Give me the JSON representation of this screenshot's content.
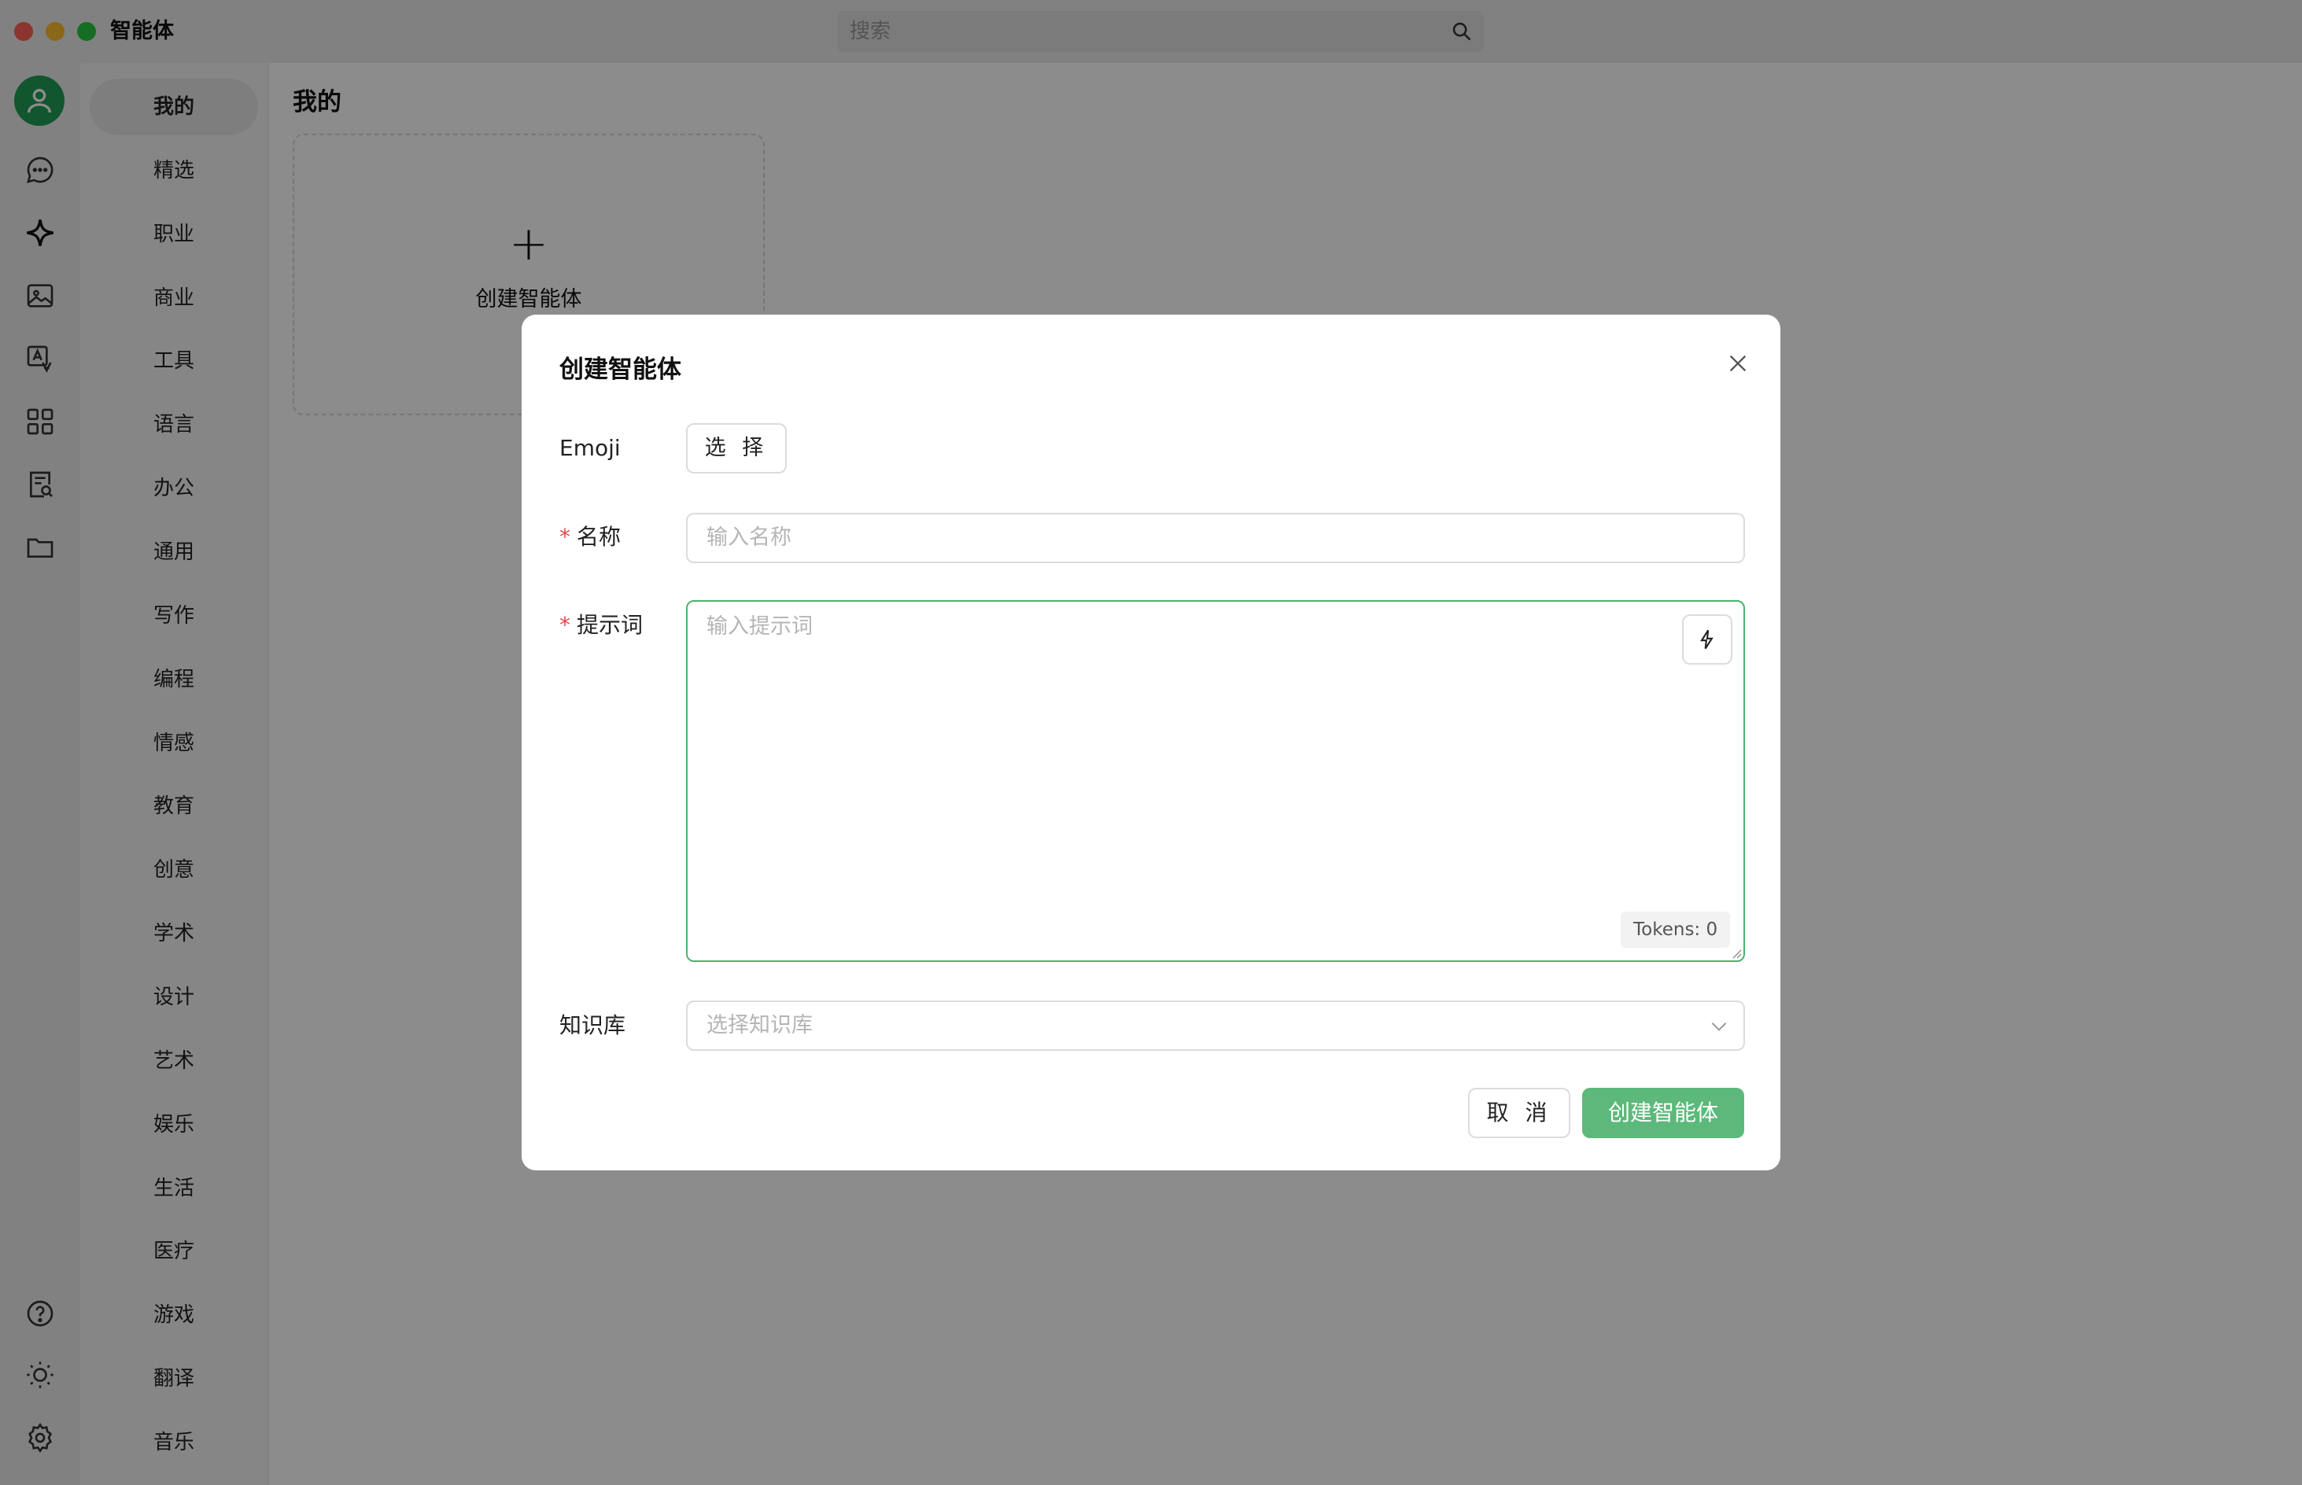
{
  "window": {
    "title": "智能体",
    "search_placeholder": "搜索"
  },
  "rail": {
    "icons": [
      "user-avatar-icon",
      "chat-bubble-icon",
      "sparkle-icon",
      "image-icon",
      "translate-icon",
      "apps-grid-icon",
      "document-search-icon",
      "folder-icon",
      "help-icon",
      "theme-sun-icon",
      "settings-gear-icon"
    ]
  },
  "categories": [
    "我的",
    "精选",
    "职业",
    "商业",
    "工具",
    "语言",
    "办公",
    "通用",
    "写作",
    "编程",
    "情感",
    "教育",
    "创意",
    "学术",
    "设计",
    "艺术",
    "娱乐",
    "生活",
    "医疗",
    "游戏",
    "翻译",
    "音乐"
  ],
  "active_category": "我的",
  "content": {
    "section_title": "我的",
    "create_card_label": "创建智能体"
  },
  "modal": {
    "title": "创建智能体",
    "emoji_label": "Emoji",
    "emoji_button": "选 择",
    "name_label": "名称",
    "name_placeholder": "输入名称",
    "prompt_label": "提示词",
    "prompt_placeholder": "输入提示词",
    "tokens": "Tokens: 0",
    "kb_label": "知识库",
    "kb_placeholder": "选择知识库",
    "cancel": "取 消",
    "submit": "创建智能体"
  },
  "colors": {
    "accent": "#5cb97b",
    "avatar": "#1f9d57",
    "required": "#e5484d"
  }
}
